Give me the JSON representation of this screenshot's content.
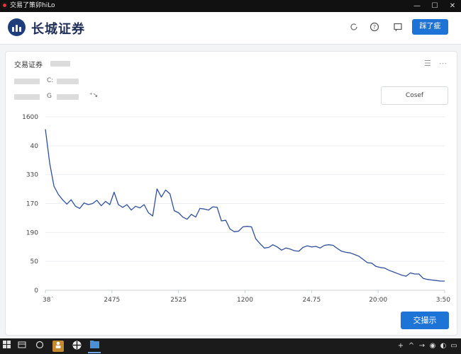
{
  "window": {
    "title": "交易了策卯hiLo",
    "controls": {
      "minimize": "—",
      "maximize": "☐",
      "close": "✕"
    }
  },
  "header": {
    "logo_text": "长城证券",
    "primary_button": "踩了疵",
    "icons": [
      "refresh-icon",
      "help-icon",
      "message-icon"
    ]
  },
  "card": {
    "title": "交易证券",
    "row1_label": "C:",
    "row2_label": "G",
    "row2_extra": "⁺↘",
    "cosef_button": "Cosef",
    "action_button": "交撮示"
  },
  "chart_data": {
    "type": "line",
    "title": "",
    "xlabel": "",
    "ylabel": "",
    "ytick_labels": [
      "1600",
      "40",
      "330",
      "170",
      "190",
      "50",
      "0"
    ],
    "xtick_labels": [
      "38˙",
      "2475",
      "2525",
      "1200",
      "24.75",
      "20:00",
      "3:50"
    ],
    "grid": true,
    "color": "#2e4f9c",
    "series": [
      {
        "values": [
          297,
          234,
          192,
          177,
          167,
          159,
          167,
          155,
          151,
          161,
          158,
          160,
          166,
          156,
          164,
          158,
          181,
          158,
          153,
          158,
          148,
          155,
          152,
          158,
          143,
          137,
          187,
          172,
          185,
          178,
          147,
          143,
          135,
          131,
          140,
          135,
          151,
          150,
          148,
          154,
          153,
          128,
          129,
          113,
          108,
          109,
          117,
          118,
          117,
          95,
          86,
          78,
          79,
          84,
          80,
          74,
          78,
          76,
          73,
          72,
          79,
          82,
          80,
          81,
          78,
          83,
          84,
          83,
          77,
          72,
          70,
          69,
          66,
          63,
          57,
          51,
          50,
          44,
          42,
          41,
          37,
          34,
          31,
          28,
          26,
          32,
          30,
          30,
          22,
          20,
          19,
          18,
          17,
          17
        ]
      }
    ]
  }
}
